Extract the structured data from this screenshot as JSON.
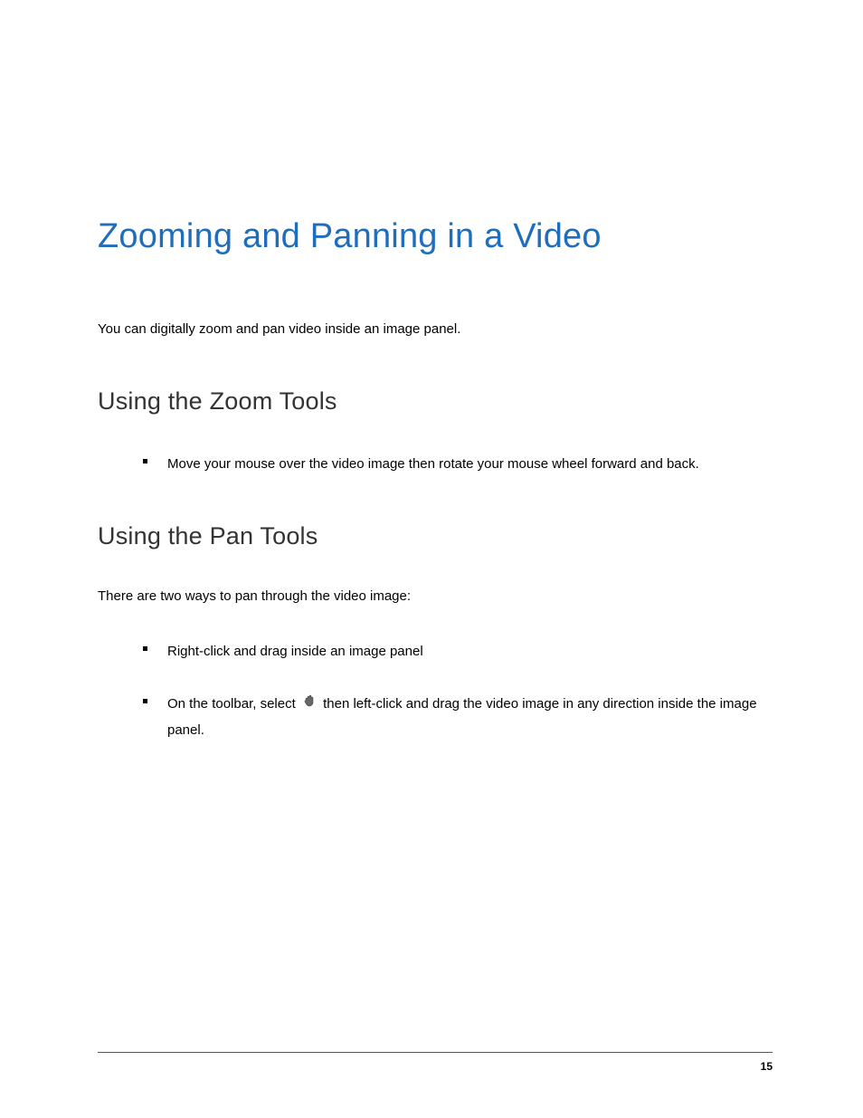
{
  "title": "Zooming and Panning in a Video",
  "intro": "You can digitally zoom and pan video inside an image panel.",
  "zoom_section": {
    "heading": "Using the Zoom Tools",
    "items": [
      "Move your mouse over the video image then rotate your mouse wheel forward and back."
    ]
  },
  "pan_section": {
    "heading": "Using the Pan Tools",
    "intro": "There are two ways to pan through the video image:",
    "items": [
      "Right-click and drag inside an image panel"
    ],
    "item2_before": "On the toolbar, select ",
    "item2_after": " then left-click and drag the video image in any direction inside the image panel."
  },
  "page_number": "15"
}
